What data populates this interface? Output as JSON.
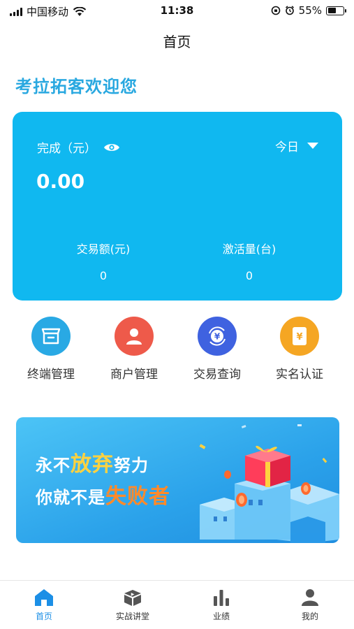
{
  "status_bar": {
    "carrier": "中国移动",
    "time": "11:38",
    "battery_percent": "55%",
    "battery_level": 0.55
  },
  "nav": {
    "title": "首页"
  },
  "welcome": "考拉拓客欢迎您",
  "stats": {
    "label": "完成（元）",
    "period": "今日",
    "value": "0.00",
    "metrics": [
      {
        "label": "交易额(元)",
        "value": "0"
      },
      {
        "label": "激活量(台)",
        "value": "0"
      }
    ]
  },
  "actions": [
    {
      "label": "终端管理",
      "icon": "terminal-box-icon",
      "color": "#29a9e4"
    },
    {
      "label": "商户管理",
      "icon": "merchant-user-icon",
      "color": "#ee5a4a"
    },
    {
      "label": "交易查询",
      "icon": "transaction-yen-icon",
      "color": "#3f62e0"
    },
    {
      "label": "实名认证",
      "icon": "verify-card-icon",
      "color": "#f5a623"
    }
  ],
  "banner": {
    "line1_prefix": "永不",
    "line1_highlight": "放弃",
    "line1_suffix": "努力",
    "line2_prefix": "你就不是",
    "line2_highlight": "失败者"
  },
  "tabbar": {
    "items": [
      {
        "label": "首页",
        "icon": "home-icon",
        "active": true
      },
      {
        "label": "实战讲堂",
        "icon": "classroom-icon",
        "active": false
      },
      {
        "label": "业绩",
        "icon": "bar-chart-icon",
        "active": false
      },
      {
        "label": "我的",
        "icon": "profile-icon",
        "active": false
      }
    ],
    "active_color": "#1c8fe6",
    "inactive_color": "#555555"
  }
}
